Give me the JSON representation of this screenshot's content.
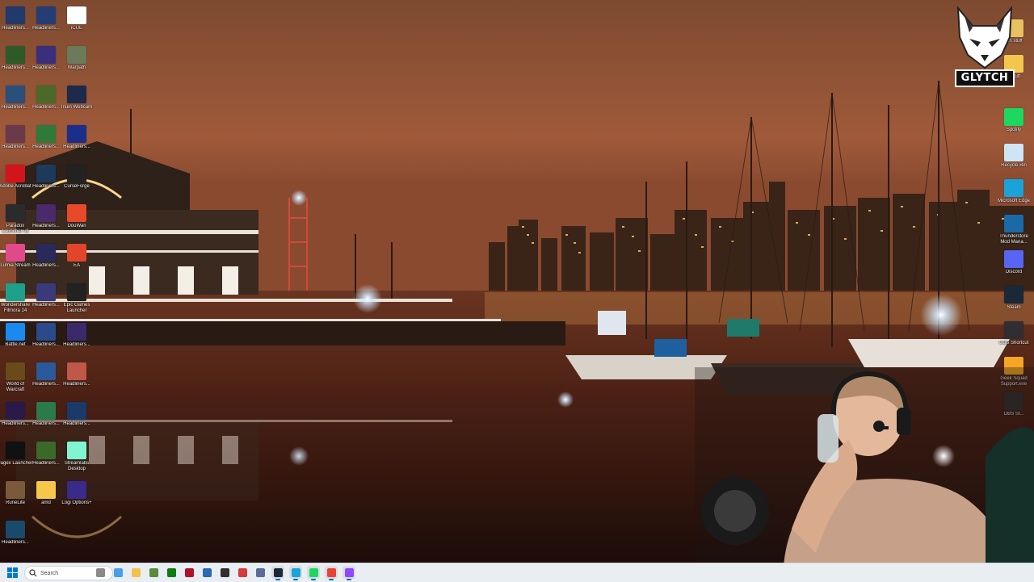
{
  "desktop": {
    "left_icons": [
      {
        "label": "Headliners...",
        "color": "#1f3a6b"
      },
      {
        "label": "Headliners...",
        "color": "#243d75"
      },
      {
        "label": "iCUE",
        "color": "#ffffff"
      },
      {
        "label": "Headliners...",
        "color": "#2e5a2a"
      },
      {
        "label": "Headliners...",
        "color": "#3a2f7a"
      },
      {
        "label": "Warpath",
        "color": "#6b7a5a"
      },
      {
        "label": "Headliners...",
        "color": "#2a4f7c"
      },
      {
        "label": "Headliners...",
        "color": "#4b6a2a"
      },
      {
        "label": "Inuin Webcam",
        "color": "#1d2a4a"
      },
      {
        "label": "Headliners...",
        "color": "#6a3a4a"
      },
      {
        "label": "Headliners...",
        "color": "#2f7a3a"
      },
      {
        "label": "Headliners...",
        "color": "#1a2f8a"
      },
      {
        "label": "Adobe Acrobat",
        "color": "#d4141c"
      },
      {
        "label": "Headliners...",
        "color": "#1e3a5a"
      },
      {
        "label": "CurseForge",
        "color": "#222222"
      },
      {
        "label": "Paradox Launcher v2",
        "color": "#2b2b2b"
      },
      {
        "label": "Headliners...",
        "color": "#4a2a6a"
      },
      {
        "label": "DouWan",
        "color": "#e64a2a"
      },
      {
        "label": "Lumia Stream",
        "color": "#e04a8a"
      },
      {
        "label": "Headliners...",
        "color": "#2a2a5a"
      },
      {
        "label": "EA",
        "color": "#e2462a"
      },
      {
        "label": "Wondershare Filmora 14",
        "color": "#1ea08a"
      },
      {
        "label": "Headliners...",
        "color": "#3a3a7a"
      },
      {
        "label": "Epic Games Launcher",
        "color": "#222222"
      },
      {
        "label": "Battle.net",
        "color": "#1a8af0"
      },
      {
        "label": "Headliners...",
        "color": "#2a4a8a"
      },
      {
        "label": "Headliners...",
        "color": "#3a2a6a"
      },
      {
        "label": "World of Warcraft",
        "color": "#6a4a1a"
      },
      {
        "label": "Headliners...",
        "color": "#2a5a9a"
      },
      {
        "label": "Headliners...",
        "color": "#c0584a"
      },
      {
        "label": "Headliners...",
        "color": "#2a1a4a"
      },
      {
        "label": "Headliners...",
        "color": "#2a7a4a"
      },
      {
        "label": "Headliners...",
        "color": "#1a3a6a"
      },
      {
        "label": "Jagex Launcher",
        "color": "#111111"
      },
      {
        "label": "Headliners...",
        "color": "#3a6a2a"
      },
      {
        "label": "Streamlabs Desktop",
        "color": "#80f5d2"
      },
      {
        "label": "RuneLite",
        "color": "#7a5a3a"
      },
      {
        "label": "amd",
        "color": "#f5c84a"
      },
      {
        "label": "Logi Options+",
        "color": "#3a2a8a"
      },
      {
        "label": "Headliners...",
        "color": "#1a4a6a"
      }
    ],
    "right_icons": [
      {
        "label": "...n stuff",
        "color": "#e8c060"
      },
      {
        "label": "...stuff",
        "color": "#f2c74c"
      },
      {
        "label": "Spotify",
        "color": "#1ed760"
      },
      {
        "label": "Recycle Bin",
        "color": "#cfe4f5"
      },
      {
        "label": "Microsoft Edge",
        "color": "#1aa3d8"
      },
      {
        "label": "Thunderstore Mod Mana...",
        "color": "#1a6aa8"
      },
      {
        "label": "Discord",
        "color": "#5865f2"
      },
      {
        "label": "Steam",
        "color": "#1b2838"
      },
      {
        "label": "OBS Shortcut",
        "color": "#302e31"
      },
      {
        "label": "Geek Squad Support.exe",
        "color": "#f5a623"
      },
      {
        "label": "OBS St...",
        "color": "#302e31"
      }
    ]
  },
  "overlay": {
    "logo_text": "GLYTCH"
  },
  "taskbar": {
    "search_placeholder": "Search",
    "apps": [
      {
        "name": "widgets-app",
        "color": "#8a8a8a"
      },
      {
        "name": "copilot-app",
        "color": "#4aa0e8"
      },
      {
        "name": "file-explorer-app",
        "color": "#f2c14e"
      },
      {
        "name": "minecraft-app",
        "color": "#5a8a3a"
      },
      {
        "name": "xbox-app",
        "color": "#107c10"
      },
      {
        "name": "adobe-app",
        "color": "#b0122a"
      },
      {
        "name": "photos-app",
        "color": "#2a6ab0"
      },
      {
        "name": "obs-app",
        "color": "#302e31"
      },
      {
        "name": "screen-tool-app",
        "color": "#d83a3a"
      },
      {
        "name": "vpn-app",
        "color": "#5a6a9a"
      },
      {
        "name": "steam-app",
        "color": "#1b2838"
      },
      {
        "name": "edge-app",
        "color": "#1aa3d8"
      },
      {
        "name": "spotify-app",
        "color": "#1ed760"
      },
      {
        "name": "chrome-app",
        "color": "#ea4335"
      },
      {
        "name": "twitch-studio-app",
        "color": "#9146ff"
      }
    ]
  }
}
